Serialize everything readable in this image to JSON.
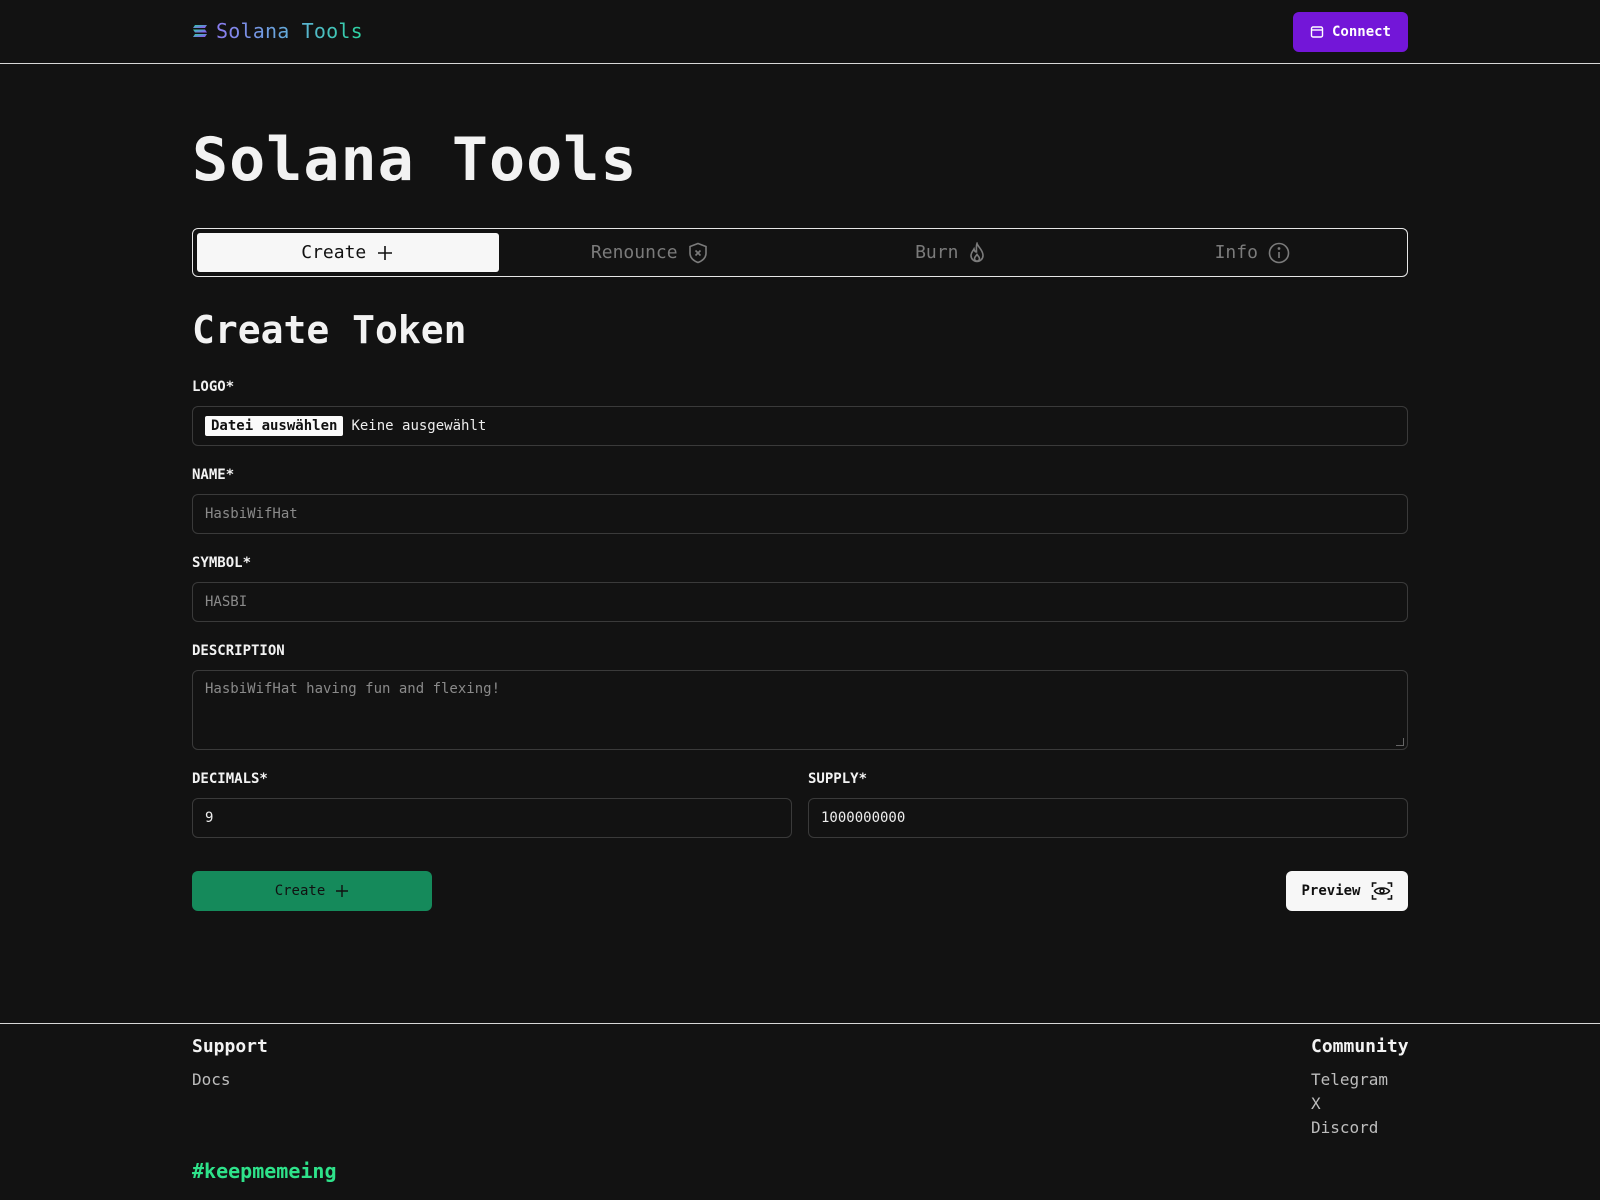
{
  "header": {
    "brand": "Solana Tools",
    "connect_label": "Connect"
  },
  "page": {
    "title": "Solana Tools"
  },
  "tabs": [
    {
      "label": "Create",
      "icon": "plus-icon",
      "active": true
    },
    {
      "label": "Renounce",
      "icon": "shield-x-icon",
      "active": false
    },
    {
      "label": "Burn",
      "icon": "flame-icon",
      "active": false
    },
    {
      "label": "Info",
      "icon": "info-icon",
      "active": false
    }
  ],
  "form": {
    "title": "Create Token",
    "logo": {
      "label": "LOGO*",
      "button": "Datei auswählen",
      "status": "Keine ausgewählt"
    },
    "name": {
      "label": "NAME*",
      "placeholder": "HasbiWifHat",
      "value": ""
    },
    "symbol": {
      "label": "SYMBOL*",
      "placeholder": "HASBI",
      "value": ""
    },
    "description": {
      "label": "DESCRIPTION",
      "placeholder": "HasbiWifHat having fun and flexing!",
      "value": ""
    },
    "decimals": {
      "label": "DECIMALS*",
      "value": "9"
    },
    "supply": {
      "label": "SUPPLY*",
      "value": "1000000000"
    },
    "create_label": "Create",
    "preview_label": "Preview"
  },
  "footer": {
    "support": {
      "heading": "Support",
      "links": [
        "Docs"
      ]
    },
    "community": {
      "heading": "Community",
      "links": [
        "Telegram",
        "X",
        "Discord"
      ]
    },
    "hashtag": "#keepmemeing"
  },
  "colors": {
    "accent_purple": "#7316d8",
    "create_green": "#158a5b",
    "hashtag_green": "#2ee28a",
    "background": "#121212"
  }
}
